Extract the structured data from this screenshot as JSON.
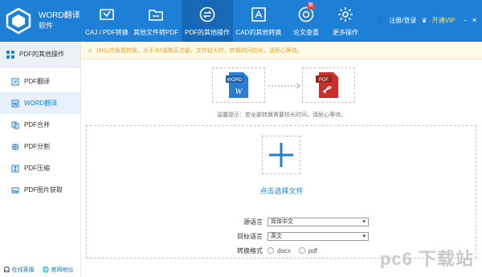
{
  "app": {
    "title_line1": "WORD翻译",
    "title_line2": "软件"
  },
  "nav": [
    {
      "label": "CAJ / PDF转换"
    },
    {
      "label": "其他文件转PDF"
    },
    {
      "label": "PDF的其他操作"
    },
    {
      "label": "CAD的其他转换"
    },
    {
      "label": "论文查重",
      "badge": "新"
    },
    {
      "label": "更多操作"
    }
  ],
  "topright": {
    "login": "注册/登录",
    "vip": "开通VIP"
  },
  "sidebar": {
    "header": "PDF的其他操作",
    "items": [
      {
        "label": "PDF翻译",
        "icon": "pdf-translate-icon"
      },
      {
        "label": "WORD翻译",
        "icon": "word-translate-icon",
        "active": true
      },
      {
        "label": "PDF合并",
        "icon": "merge-icon"
      },
      {
        "label": "PDF分割",
        "icon": "split-icon"
      },
      {
        "label": "PDF压缩",
        "icon": "compress-icon"
      },
      {
        "label": "PDF图片获取",
        "icon": "image-icon"
      }
    ],
    "footer": {
      "service": "在线客服",
      "website": "官网地址"
    }
  },
  "notice": {
    "text": "1M以内免费转换，大于1M请购买注册，文件较大时，转换时间较长，请耐心等待。"
  },
  "conversion": {
    "from_label": "WORD",
    "to_label": "PDF",
    "tip": "温馨提示：若全部转换需要较长时间，请耐心等待。"
  },
  "dropzone": {
    "select_label": "点击选择文件"
  },
  "form": {
    "source_label": "源语言",
    "source_value": "简体中文",
    "target_label": "目标语言",
    "target_value": "英文",
    "format_label": "转换格式",
    "format_options": [
      "docx",
      "pdf"
    ]
  },
  "watermark": {
    "text": "pc6 下载站"
  },
  "colors": {
    "accent": "#1e7fd6",
    "active_nav": "#1769b8",
    "notice": "#e8a02a",
    "pdf_red": "#c9302c"
  }
}
